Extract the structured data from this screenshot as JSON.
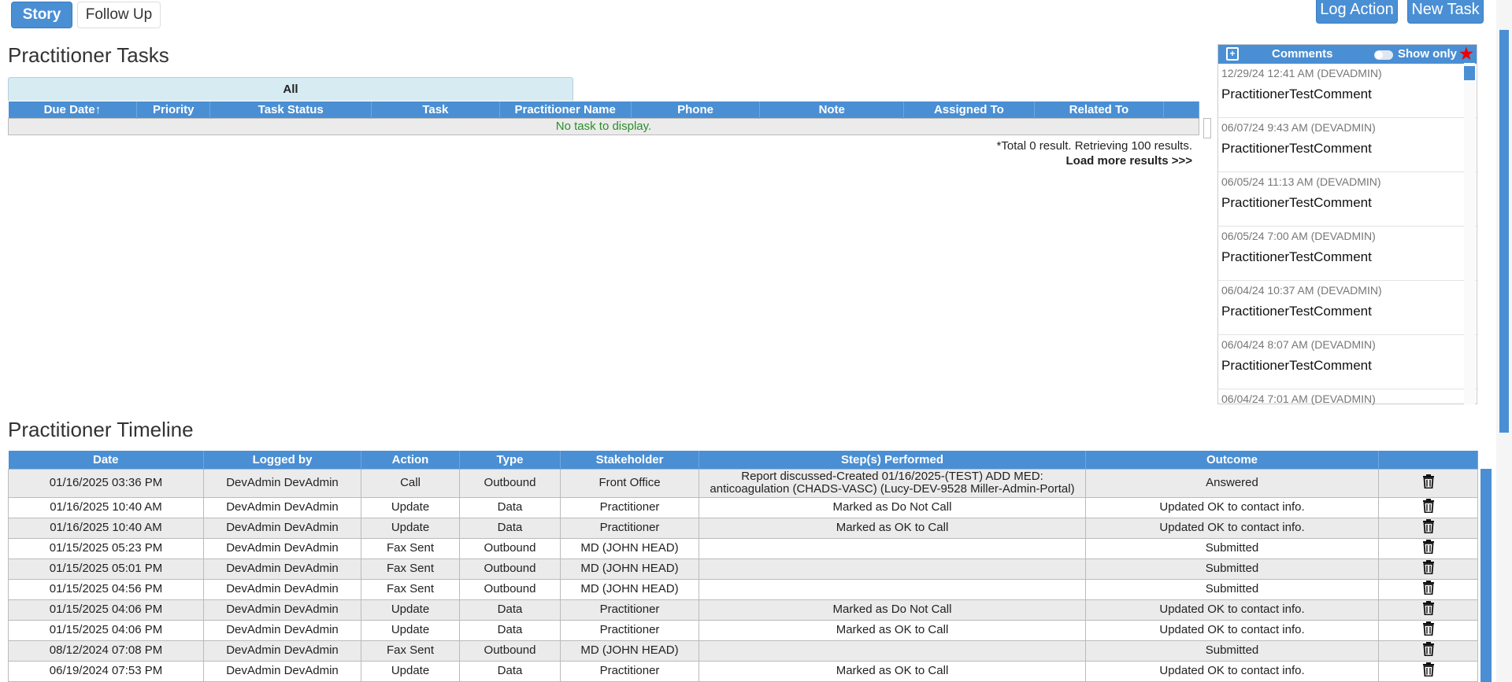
{
  "tabs": {
    "story": "Story",
    "follow_up": "Follow Up"
  },
  "actions": {
    "log_action": "Log Action",
    "new_task": "New Task"
  },
  "tasks": {
    "title": "Practitioner Tasks",
    "filter_tab": "All",
    "columns": [
      "Due Date↑",
      "Priority",
      "Task Status",
      "Task",
      "Practitioner Name",
      "Phone",
      "Note",
      "Assigned To",
      "Related To",
      ""
    ],
    "empty_message": "No task to display.",
    "result_info": "*Total 0 result. Retrieving 100 results.",
    "load_more": "Load more results >>>"
  },
  "comments": {
    "title": "Comments",
    "show_only": "Show only",
    "items": [
      {
        "meta": "12/29/24 12:41 AM (DEVADMIN)",
        "text": "PractitionerTestComment"
      },
      {
        "meta": "06/07/24 9:43 AM (DEVADMIN)",
        "text": "PractitionerTestComment"
      },
      {
        "meta": "06/05/24 11:13 AM (DEVADMIN)",
        "text": "PractitionerTestComment"
      },
      {
        "meta": "06/05/24 7:00 AM (DEVADMIN)",
        "text": "PractitionerTestComment"
      },
      {
        "meta": "06/04/24 10:37 AM (DEVADMIN)",
        "text": "PractitionerTestComment"
      },
      {
        "meta": "06/04/24 8:07 AM (DEVADMIN)",
        "text": "PractitionerTestComment"
      },
      {
        "meta": "06/04/24 7:01 AM (DEVADMIN)",
        "text": ""
      }
    ]
  },
  "timeline": {
    "title": "Practitioner Timeline",
    "columns": [
      "Date",
      "Logged by",
      "Action",
      "Type",
      "Stakeholder",
      "Step(s) Performed",
      "Outcome",
      ""
    ],
    "rows": [
      {
        "date": "01/16/2025 03:36 PM",
        "logged_by": "DevAdmin DevAdmin",
        "action": "Call",
        "type": "Outbound",
        "stakeholder": "Front Office",
        "steps": "Report discussed-Created 01/16/2025-(TEST) ADD MED: anticoagulation (CHADS-VASC) (Lucy-DEV-9528 Miller-Admin-Portal)",
        "outcome": "Answered"
      },
      {
        "date": "01/16/2025 10:40 AM",
        "logged_by": "DevAdmin DevAdmin",
        "action": "Update",
        "type": "Data",
        "stakeholder": "Practitioner",
        "steps": "Marked as Do Not Call",
        "outcome": "Updated OK to contact info."
      },
      {
        "date": "01/16/2025 10:40 AM",
        "logged_by": "DevAdmin DevAdmin",
        "action": "Update",
        "type": "Data",
        "stakeholder": "Practitioner",
        "steps": "Marked as OK to Call",
        "outcome": "Updated OK to contact info."
      },
      {
        "date": "01/15/2025 05:23 PM",
        "logged_by": "DevAdmin DevAdmin",
        "action": "Fax Sent",
        "type": "Outbound",
        "stakeholder": "MD (JOHN HEAD)",
        "steps": "",
        "outcome": "Submitted"
      },
      {
        "date": "01/15/2025 05:01 PM",
        "logged_by": "DevAdmin DevAdmin",
        "action": "Fax Sent",
        "type": "Outbound",
        "stakeholder": "MD (JOHN HEAD)",
        "steps": "",
        "outcome": "Submitted"
      },
      {
        "date": "01/15/2025 04:56 PM",
        "logged_by": "DevAdmin DevAdmin",
        "action": "Fax Sent",
        "type": "Outbound",
        "stakeholder": "MD (JOHN HEAD)",
        "steps": "",
        "outcome": "Submitted"
      },
      {
        "date": "01/15/2025 04:06 PM",
        "logged_by": "DevAdmin DevAdmin",
        "action": "Update",
        "type": "Data",
        "stakeholder": "Practitioner",
        "steps": "Marked as Do Not Call",
        "outcome": "Updated OK to contact info."
      },
      {
        "date": "01/15/2025 04:06 PM",
        "logged_by": "DevAdmin DevAdmin",
        "action": "Update",
        "type": "Data",
        "stakeholder": "Practitioner",
        "steps": "Marked as OK to Call",
        "outcome": "Updated OK to contact info."
      },
      {
        "date": "08/12/2024 07:08 PM",
        "logged_by": "DevAdmin DevAdmin",
        "action": "Fax Sent",
        "type": "Outbound",
        "stakeholder": "MD (JOHN HEAD)",
        "steps": "",
        "outcome": "Submitted"
      },
      {
        "date": "06/19/2024 07:53 PM",
        "logged_by": "DevAdmin DevAdmin",
        "action": "Update",
        "type": "Data",
        "stakeholder": "Practitioner",
        "steps": "Marked as OK to Call",
        "outcome": "Updated OK to contact info."
      }
    ]
  },
  "colors": {
    "accent": "#4a8fd4",
    "tab_bg": "#d7ebf2",
    "empty_text": "#2a8f2a",
    "star": "#e00000"
  }
}
